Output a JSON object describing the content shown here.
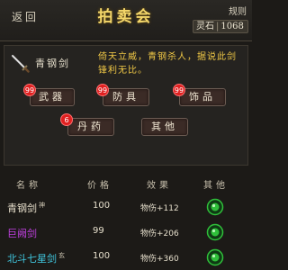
{
  "header": {
    "back_label": "返回",
    "title": "拍卖会",
    "rules_label": "规则",
    "currency_label": "灵石",
    "currency_value": "1068"
  },
  "featured": {
    "name": "青钢剑",
    "description": "倚天立威，青钢杀人，据说此剑锋利无比。",
    "icon": "sword-icon"
  },
  "categories": [
    {
      "label": "武器",
      "badge": "99"
    },
    {
      "label": "防具",
      "badge": "99"
    },
    {
      "label": "饰品",
      "badge": "99"
    },
    {
      "label": "丹药",
      "badge": "6"
    },
    {
      "label": "其他",
      "badge": ""
    }
  ],
  "table": {
    "headers": [
      "名称",
      "价格",
      "效果",
      "其他"
    ],
    "rows": [
      {
        "name": "青钢剑",
        "tag": "神",
        "price": "100",
        "effect": "物伤+112",
        "name_color": "#e8e0cc"
      },
      {
        "name": "巨阙剑",
        "tag": "",
        "price": "99",
        "effect": "物伤+206",
        "name_color": "#c040e0"
      },
      {
        "name": "北斗七星剑",
        "tag": "玄",
        "price": "100",
        "effect": "物伤+360",
        "name_color": "#40c8e0"
      }
    ],
    "action_icon": "green-jade-orb-icon"
  },
  "colors": {
    "title": "#f3d66a",
    "description": "#f0c846",
    "badge": "#e02020",
    "orb": "#2fbf3a"
  }
}
